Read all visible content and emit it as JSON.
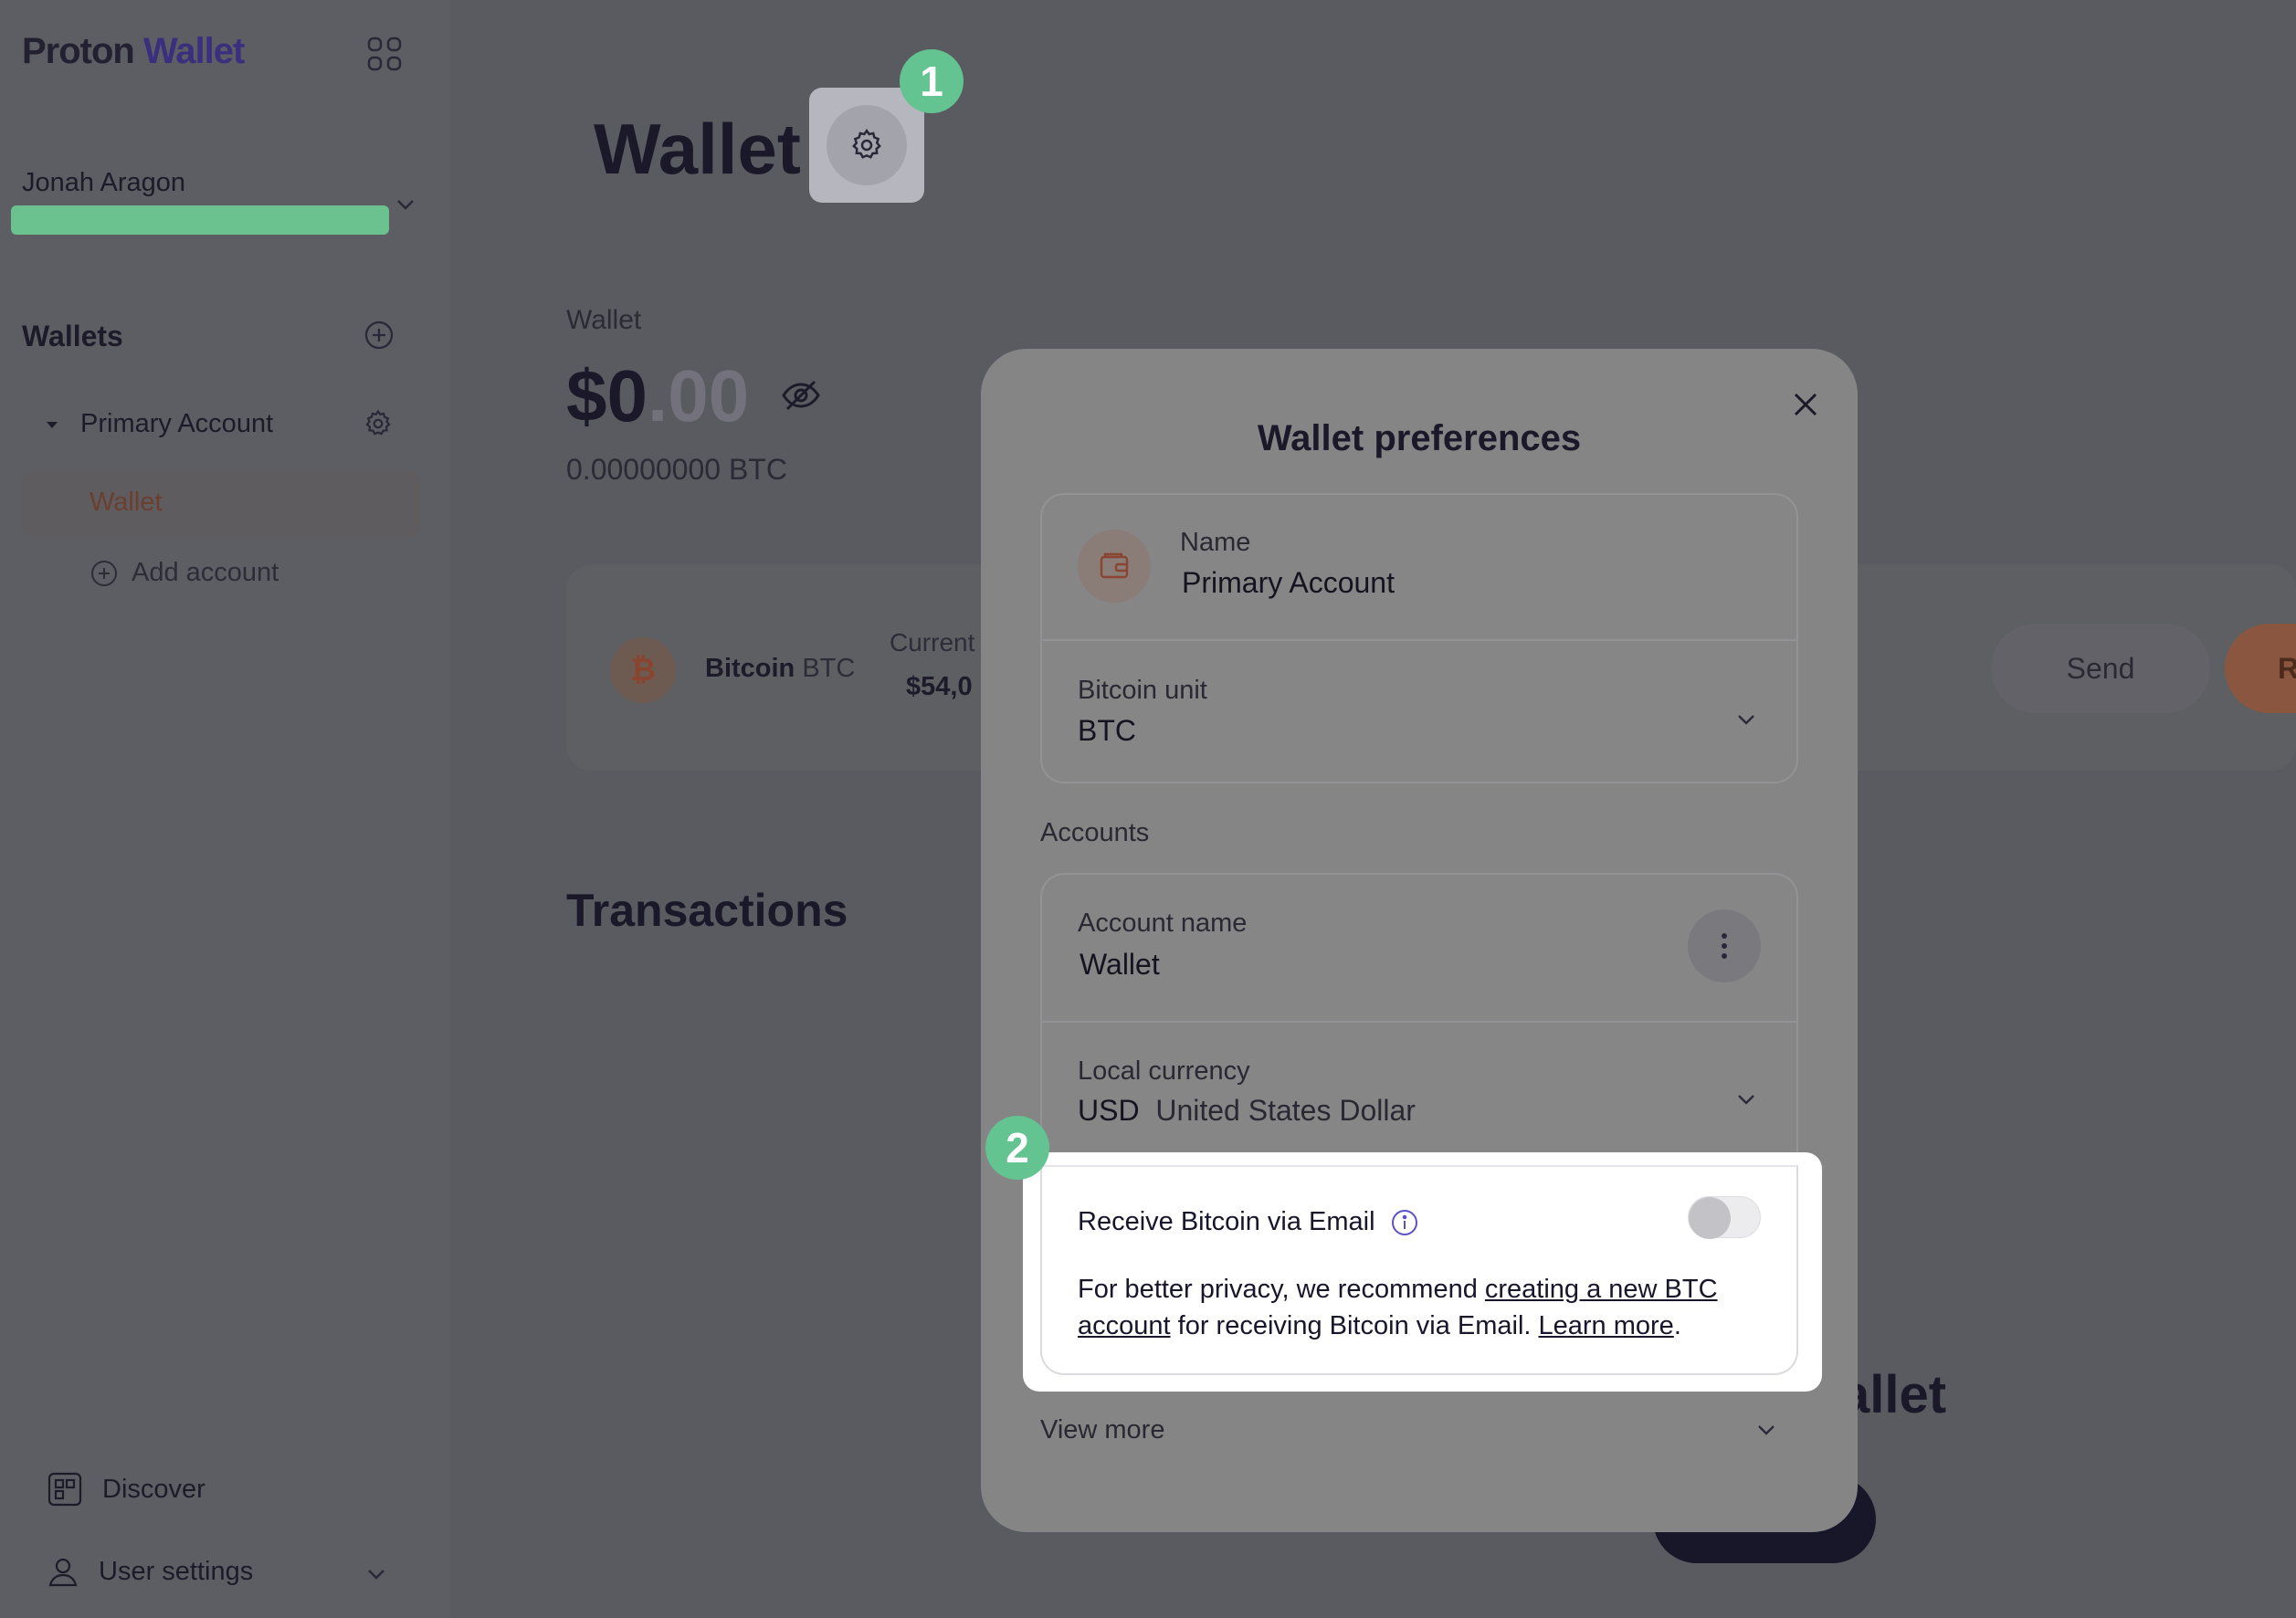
{
  "sidebar": {
    "logo_prefix": "Proton",
    "logo_suffix": "Wallet",
    "user_name": "Jonah Aragon",
    "wallets_title": "Wallets",
    "primary_account": "Primary Account",
    "wallet_item": "Wallet",
    "add_account": "Add account",
    "discover": "Discover",
    "user_settings": "User settings"
  },
  "main": {
    "title": "Wallet",
    "balance_label": "Wallet",
    "balance_whole": "$0",
    "balance_cents": ".00",
    "balance_btc": "0.00000000 BTC",
    "asset_name": "Bitcoin",
    "asset_ticker": "BTC",
    "current_label": "Current",
    "current_price": "$54,0",
    "send_label": "Send",
    "receive_label": "R",
    "transactions_title": "Transactions",
    "bg_fragment": "allet"
  },
  "badges": {
    "step1": "1",
    "step2": "2"
  },
  "modal": {
    "title": "Wallet preferences",
    "name_label": "Name",
    "name_value": "Primary Account",
    "unit_label": "Bitcoin unit",
    "unit_value": "BTC",
    "accounts_label": "Accounts",
    "account_name_label": "Account name",
    "account_name_value": "Wallet",
    "currency_label": "Local currency",
    "currency_code": "USD",
    "currency_name": "United States Dollar",
    "email_title": "Receive Bitcoin via Email",
    "email_toggle_on": false,
    "email_desc_1": "For better privacy, we recommend ",
    "email_link_1": "creating a new BTC account",
    "email_desc_2": " for receiving Bitcoin via Email. ",
    "email_link_2": "Learn more",
    "email_desc_3": ".",
    "view_more": "View more"
  },
  "colors": {
    "badge": "#63c391",
    "accent_purple": "#3a2f7e",
    "bitcoin_orange": "#8a4530"
  }
}
